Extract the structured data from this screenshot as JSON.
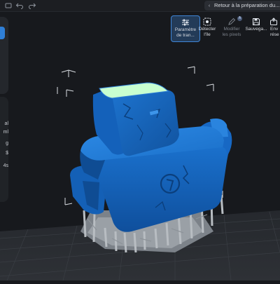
{
  "app": {
    "back_label": "Retour à la préparation du..."
  },
  "toolbar": {
    "items": [
      {
        "icon": "sliders-icon",
        "label_1": "Paramètre",
        "label_2": "de tran..."
      },
      {
        "icon": "detect-island-icon",
        "label_1": "Détecter",
        "label_2": "l'île"
      },
      {
        "icon": "edit-pixels-icon",
        "label_1": "Modifier",
        "label_2": "les pixels"
      },
      {
        "icon": "save-icon",
        "label_1": "Sauvega...",
        "label_2": ""
      },
      {
        "icon": "export-icon",
        "label_1": "Env",
        "label_2": "rése"
      }
    ]
  },
  "left_values": [
    "al",
    "ml",
    "g",
    "$",
    "4s"
  ],
  "colors": {
    "model_blue": "#1565c0",
    "model_blue_light": "#2a83e0",
    "model_blue_dark": "#0d3f7a",
    "support_grey": "#8c9299",
    "face_highlight": "#c8ffd0",
    "accent": "#2f7fd6",
    "background": "#17191d"
  }
}
